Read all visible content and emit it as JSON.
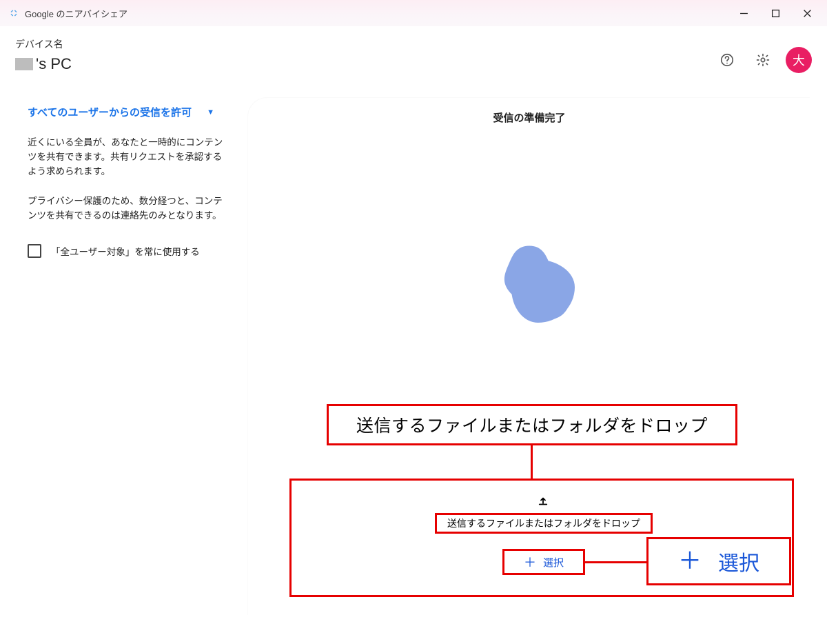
{
  "titlebar": {
    "app_title": "Google のニアバイシェア"
  },
  "header": {
    "device_label": "デバイス名",
    "device_name_suffix": "'s PC",
    "avatar_text": "大"
  },
  "sidebar": {
    "visibility_dropdown_label": "すべてのユーザーからの受信を許可",
    "description1": "近くにいる全員が、あなたと一時的にコンテンツを共有できます。共有リクエストを承認するよう求められます。",
    "description2": "プライバシー保護のため、数分経つと、コンテンツを共有できるのは連絡先のみとなります。",
    "always_everyone_label": "「全ユーザー対象」を常に使用する"
  },
  "main": {
    "ready_status": "受信の準備完了",
    "drop_prompt_big": "送信するファイルまたはフォルダをドロップ",
    "drop_prompt_small": "送信するファイルまたはフォルダをドロップ",
    "select_label": "選択",
    "select_label_big": "選択"
  },
  "icons": {
    "app": "nearby-share-icon",
    "help": "help-icon",
    "settings": "gear-icon",
    "minimize": "minimize-icon",
    "maximize": "maximize-icon",
    "close": "close-icon",
    "caret": "▼",
    "plus": "＋",
    "upload": "upload-icon"
  },
  "colors": {
    "accent_blue": "#1a73e8",
    "avatar_pink": "#e91e63",
    "annotation_red": "#e60000",
    "blob_blue": "#8aa6e6"
  }
}
